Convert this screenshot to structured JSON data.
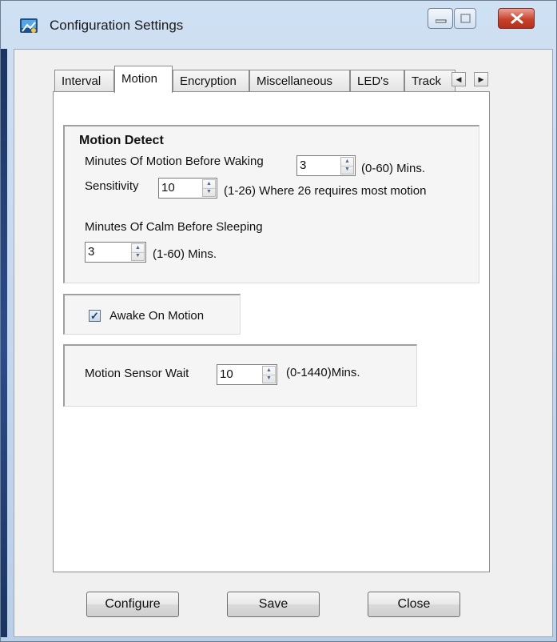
{
  "window": {
    "title": "Configuration Settings"
  },
  "tabs": [
    {
      "label": "Interval"
    },
    {
      "label": "Motion"
    },
    {
      "label": "Encryption"
    },
    {
      "label": "Miscellaneous"
    },
    {
      "label": "LED's"
    },
    {
      "label": "Track"
    }
  ],
  "motion_detect": {
    "heading": "Motion Detect",
    "wake_label": "Minutes Of Motion Before Waking",
    "wake_value": "3",
    "wake_range": "(0-60) Mins.",
    "sensitivity_label": "Sensitivity",
    "sensitivity_value": "10",
    "sensitivity_range": "(1-26) Where 26 requires most motion",
    "calm_label": "Minutes Of Calm Before Sleeping",
    "calm_value": "3",
    "calm_range": "(1-60) Mins."
  },
  "awake_on_motion": {
    "label": "Awake On Motion",
    "checked": true
  },
  "sensor_wait": {
    "label": "Motion Sensor Wait",
    "value": "10",
    "range": "(0-1440)Mins."
  },
  "buttons": {
    "configure": "Configure",
    "save": "Save",
    "close": "Close"
  }
}
